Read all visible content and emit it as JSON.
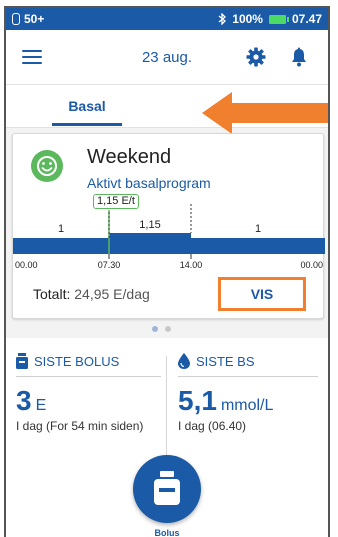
{
  "statusbar": {
    "left_text": "50+",
    "battery": "100%",
    "time": "07.47"
  },
  "header": {
    "date": "23 aug."
  },
  "tabs": [
    {
      "label": "Basal"
    }
  ],
  "program": {
    "name": "Weekend",
    "subtitle": "Aktivt basalprogram",
    "current_rate": "1,15 E/t",
    "segments": [
      {
        "label": "1"
      },
      {
        "label": "1,15"
      },
      {
        "label": "1"
      }
    ],
    "times": [
      "00.00",
      "07.30",
      "14.00",
      "00.00"
    ],
    "total_label": "Totalt:",
    "total_value": "24,95 E/dag",
    "view_button": "VIS"
  },
  "last_bolus": {
    "title": "SISTE BOLUS",
    "value": "3",
    "unit": "E",
    "detail": "I dag (For 54 min siden)"
  },
  "last_bg": {
    "title": "SISTE BS",
    "value": "5,1",
    "unit": "mmol/L",
    "detail": "I dag (06.40)"
  },
  "bolus_button": {
    "label": "Bolus"
  },
  "colors": {
    "brand_blue": "#1b5aa6",
    "highlight_orange": "#f07f2e",
    "active_green": "#5cb85c"
  },
  "icons": {
    "status_left": "phone-icon",
    "status_right": [
      "bluetooth-icon",
      "battery-icon"
    ],
    "menu": "hamburger-icon",
    "settings": "gear-icon",
    "alerts": "bell-icon",
    "program": "smiley-icon",
    "bolus": "insulin-vial-icon",
    "bg": "blood-drop-icon"
  }
}
